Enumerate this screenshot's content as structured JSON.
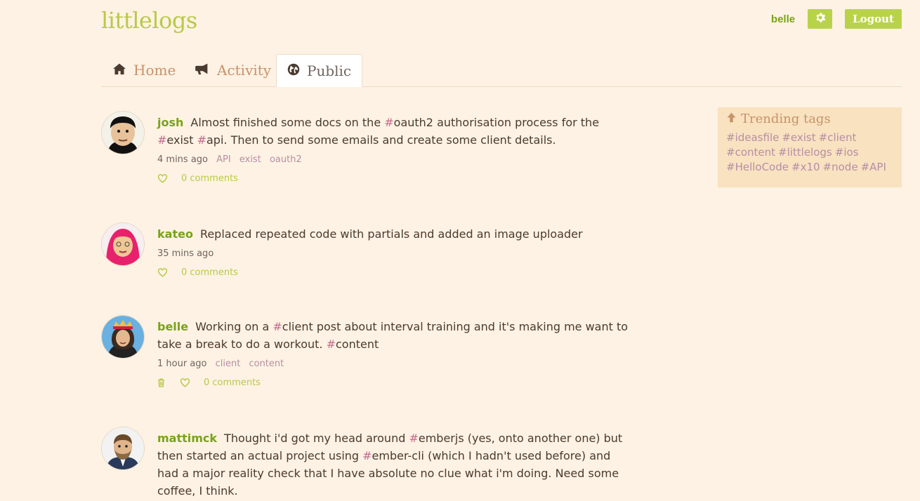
{
  "app": {
    "title": "littlelogs"
  },
  "header": {
    "username": "belle",
    "settings_icon": "gear-icon",
    "logout_label": "Logout"
  },
  "nav": {
    "tabs": [
      {
        "label": "Home",
        "icon": "home-icon",
        "active": false
      },
      {
        "label": "Activity",
        "icon": "megaphone-icon",
        "active": false
      },
      {
        "label": "Public",
        "icon": "globe-icon",
        "active": true
      }
    ]
  },
  "feed": {
    "posts": [
      {
        "author": "josh",
        "text": [
          {
            "t": "Almost finished some docs on the "
          },
          {
            "t": "#",
            "h": true
          },
          {
            "t": "oauth2 authorisation process for the "
          },
          {
            "t": "#",
            "h": true
          },
          {
            "t": "exist "
          },
          {
            "t": "#",
            "h": true
          },
          {
            "t": "api. Then to send some emails and create some client details."
          }
        ],
        "time": "4 mins ago",
        "tags": [
          "API",
          "exist",
          "oauth2"
        ],
        "comments": "0 comments",
        "can_delete": false
      },
      {
        "author": "kateo",
        "text": [
          {
            "t": "Replaced repeated code with partials and added an image uploader"
          }
        ],
        "time": "35 mins ago",
        "tags": [],
        "comments": "0 comments",
        "can_delete": false
      },
      {
        "author": "belle",
        "text": [
          {
            "t": "Working on a "
          },
          {
            "t": "#",
            "h": true
          },
          {
            "t": "client post about interval training and it's making me want to take a break to do a workout. "
          },
          {
            "t": "#",
            "h": true
          },
          {
            "t": "content"
          }
        ],
        "time": "1 hour ago",
        "tags": [
          "client",
          "content"
        ],
        "comments": "0 comments",
        "can_delete": true
      },
      {
        "author": "mattimck",
        "text": [
          {
            "t": "Thought i'd got my head around "
          },
          {
            "t": "#",
            "h": true
          },
          {
            "t": "emberjs (yes, onto another one) but then started an actual project using "
          },
          {
            "t": "#",
            "h": true
          },
          {
            "t": "ember-cli (which I hadn't used before) and had a major reality check that I have absolute no clue what i'm doing. Need some coffee, I think."
          }
        ],
        "time": "",
        "tags": [],
        "comments": "",
        "can_delete": false
      }
    ]
  },
  "sidebar": {
    "trending_title": "Trending tags",
    "tags": [
      "#ideasfile",
      "#exist",
      "#client",
      "#content",
      "#littlelogs",
      "#ios",
      "#HelloCode",
      "#x10",
      "#node",
      "#API"
    ]
  },
  "colors": {
    "background": "#fdf2e3",
    "accent_green": "#b8d34a",
    "author_green": "#7aa21a",
    "hashtag": "#c36b8f",
    "sidebar_bg": "#f9e2c0"
  }
}
